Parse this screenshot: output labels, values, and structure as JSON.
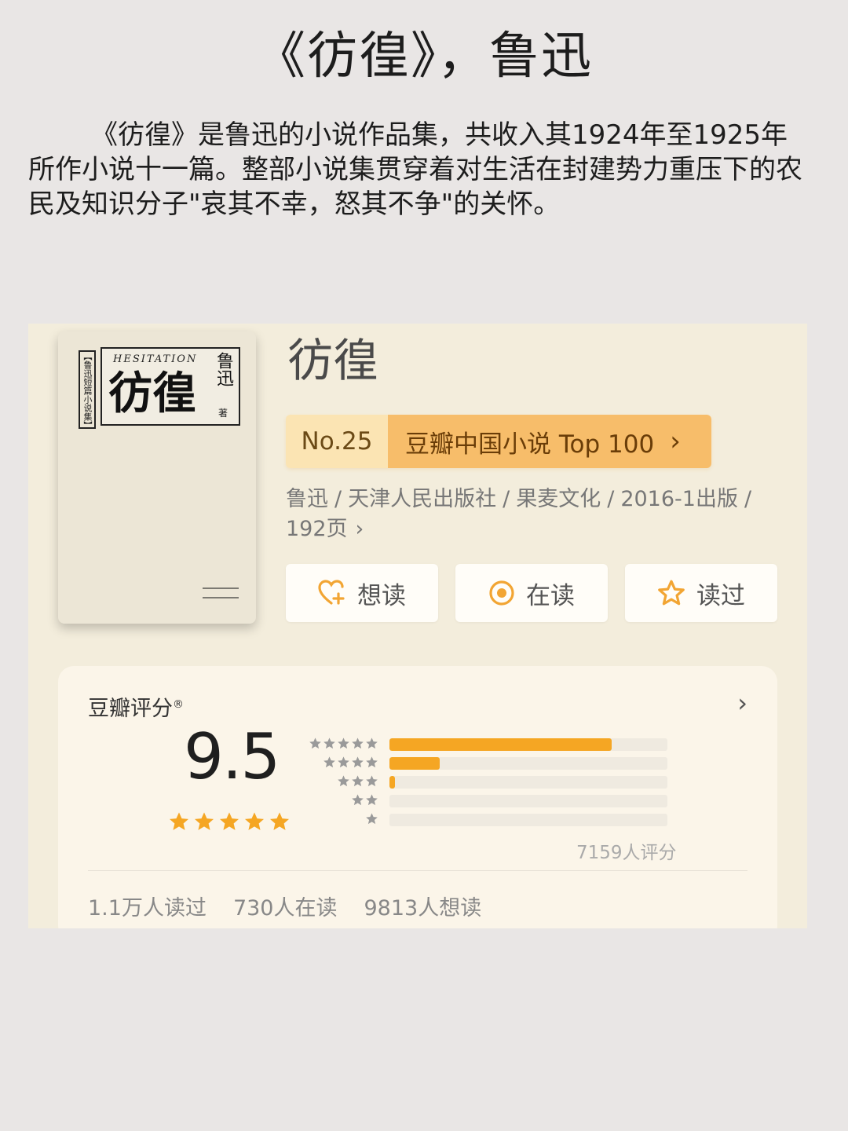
{
  "headline": "《彷徨》，鲁迅",
  "intro": "《彷徨》是鲁迅的小说作品集，共收入其1924年至1925年所作小说十一篇。整部小说集贯穿着对生活在封建势力重压下的农民及知识分子\"哀其不幸，怒其不争\"的关怀。",
  "cover": {
    "side_text": "【鲁迅短篇小说集】",
    "english_title": "HESITATION",
    "chinese_title": "彷徨",
    "author": "鲁迅",
    "author_suffix": "著"
  },
  "book": {
    "title": "彷徨",
    "rank_no": "No.25",
    "rank_list": "豆瓣中国小说 Top 100",
    "meta": [
      "鲁迅",
      "天津人民出版社",
      "果麦文化",
      "2016-1出版",
      "192页"
    ]
  },
  "actions": [
    {
      "label": "想读",
      "icon": "heart-plus-icon"
    },
    {
      "label": "在读",
      "icon": "target-icon"
    },
    {
      "label": "读过",
      "icon": "star-outline-icon"
    }
  ],
  "rating": {
    "label": "豆瓣评分",
    "registered_mark": "®",
    "score": "9.5",
    "stars_filled": 5,
    "count_text": "7159人评分",
    "distribution": [
      {
        "stars": 5,
        "fraction": 0.8
      },
      {
        "stars": 4,
        "fraction": 0.18
      },
      {
        "stars": 3,
        "fraction": 0.02
      },
      {
        "stars": 2,
        "fraction": 0.0
      },
      {
        "stars": 1,
        "fraction": 0.0
      }
    ],
    "stats": [
      "1.1万人读过",
      "730人在读",
      "9813人想读"
    ]
  },
  "colors": {
    "accent": "#f5a623",
    "rank_bg": "#f7bd6a",
    "card_bg": "#f3eddc"
  }
}
